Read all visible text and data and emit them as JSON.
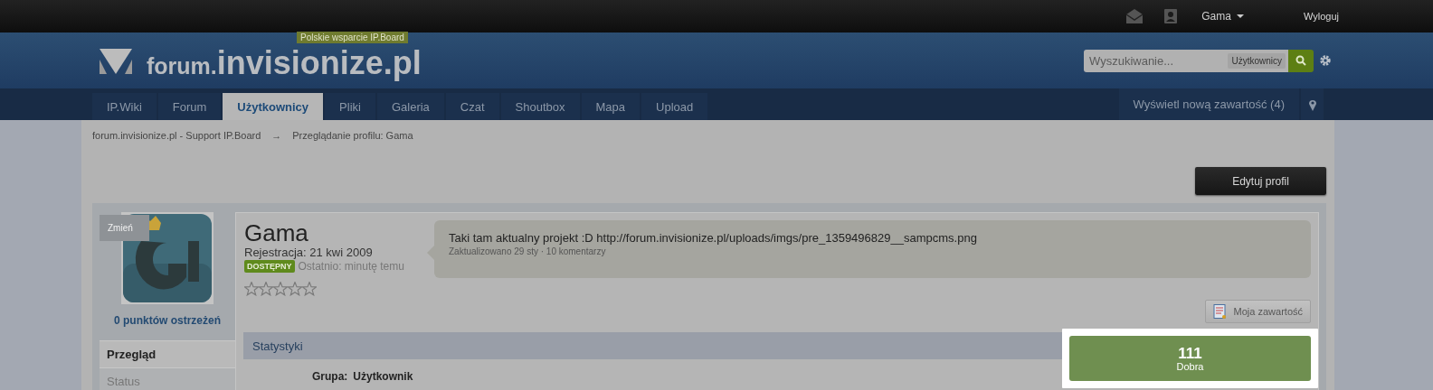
{
  "top_bar": {
    "user_menu": "Gama",
    "logout": "Wyloguj"
  },
  "header": {
    "tagline": "Polskie wsparcie IP.Board",
    "logo_prefix": "forum.",
    "logo_main": "invisionize.pl",
    "search": {
      "placeholder": "Wyszukiwanie...",
      "scope": "Użytkownicy"
    }
  },
  "nav": {
    "tabs": [
      {
        "label": "IP.Wiki",
        "selected": false
      },
      {
        "label": "Forum",
        "selected": false
      },
      {
        "label": "Użytkownicy",
        "selected": true
      },
      {
        "label": "Pliki",
        "selected": false
      },
      {
        "label": "Galeria",
        "selected": false
      },
      {
        "label": "Czat",
        "selected": false
      },
      {
        "label": "Shoutbox",
        "selected": false
      },
      {
        "label": "Mapa",
        "selected": false
      },
      {
        "label": "Upload",
        "selected": false
      }
    ],
    "new_content": "Wyświetl nową zawartość (4)"
  },
  "breadcrumb": {
    "items": [
      "forum.invisionize.pl - Support IP.Board",
      "Przeglądanie profilu: Gama"
    ],
    "separator": "→"
  },
  "edit_button": "Edytuj profil",
  "profile": {
    "change_photo": "Zmień",
    "warnings": "0 punktów ostrzeżeń",
    "menu": [
      {
        "label": "Przegląd",
        "selected": true
      },
      {
        "label": "Status",
        "selected": false
      }
    ],
    "name": "Gama",
    "registered": "Rejestracja: 21 kwi 2009",
    "online_badge": "DOSTĘPNY",
    "last_seen": "Ostatnio: minutę temu",
    "stars": 0,
    "status_text": "Taki tam aktualny projekt :D http://forum.invisionize.pl/uploads/imgs/pre_1359496829__sampcms.png",
    "status_meta": "Zaktualizowano 29 sty · 10 komentarzy",
    "content_button": "Moja zawartość",
    "stats_title": "Statystyki",
    "reputation": {
      "value": "111",
      "label": "Dobra"
    },
    "stats": [
      {
        "label": "Grupa:",
        "value": "Użytkownik"
      }
    ]
  }
}
